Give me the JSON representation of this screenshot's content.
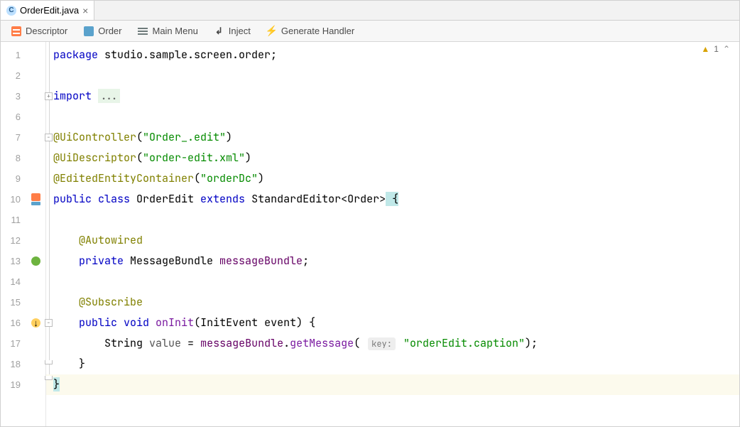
{
  "tab": {
    "name": "OrderEdit.java"
  },
  "toolbar": {
    "descriptor": "Descriptor",
    "order": "Order",
    "main_menu": "Main Menu",
    "inject": "Inject",
    "generate": "Generate Handler"
  },
  "inspection": {
    "warn_count": "1"
  },
  "gutter": {
    "lines": [
      "1",
      "2",
      "3",
      "6",
      "7",
      "8",
      "9",
      "10",
      "11",
      "12",
      "13",
      "14",
      "15",
      "16",
      "17",
      "18",
      "19"
    ]
  },
  "code": {
    "l1": {
      "kw": "package",
      "rest": " studio.sample.screen.order;"
    },
    "l3": {
      "kw": "import ",
      "fold": "..."
    },
    "l7": {
      "ann": "@UiController",
      "paren_open": "(",
      "str": "\"Order_.edit\"",
      "paren_close": ")"
    },
    "l8": {
      "ann": "@UiDescriptor",
      "paren_open": "(",
      "str": "\"order-edit.xml\"",
      "paren_close": ")"
    },
    "l9": {
      "ann": "@EditedEntityContainer",
      "paren_open": "(",
      "str": "\"orderDc\"",
      "paren_close": ")"
    },
    "l10": {
      "kw1": "public ",
      "kw2": "class ",
      "name": "OrderEdit ",
      "ext": "extends ",
      "sup": "StandardEditor",
      "gen1": "<",
      "gp": "Order",
      "gen2": ">",
      "brace": " {"
    },
    "l12": {
      "indent": "    ",
      "ann": "@Autowired"
    },
    "l13": {
      "indent": "    ",
      "kw": "private ",
      "type": "MessageBundle ",
      "fld": "messageBundle",
      "semi": ";"
    },
    "l15": {
      "indent": "    ",
      "ann": "@Subscribe"
    },
    "l16": {
      "indent": "    ",
      "kw1": "public ",
      "kw2": "void ",
      "mth": "onInit",
      "sig": "(InitEvent event) {"
    },
    "l17": {
      "indent": "        ",
      "t": "String ",
      "var": "value",
      "eq": " = ",
      "fld": "messageBundle",
      "dot": ".",
      "mth": "getMessage",
      "po": "( ",
      "hint": "key:",
      "sp": " ",
      "str": "\"orderEdit.caption\"",
      "pc": ");"
    },
    "l18": {
      "indent": "    ",
      "brace": "}"
    },
    "l19": {
      "brace": "}"
    }
  }
}
